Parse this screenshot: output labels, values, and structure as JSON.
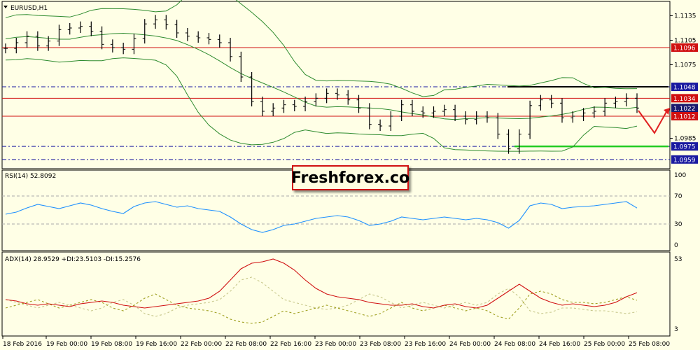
{
  "chart_data": {
    "type": "line",
    "symbol_label": "EURUSD,H1",
    "brand": "Freshforex.co",
    "price_axis": {
      "ticks": [
        {
          "value": 1.1135,
          "label": "1.1135"
        },
        {
          "value": 1.1105,
          "label": "1.1105"
        },
        {
          "value": 1.1075,
          "label": "1.1075"
        },
        {
          "value": 1.0985,
          "label": "1.0985"
        }
      ],
      "levels": [
        {
          "value": 1.1096,
          "label": "1.1096",
          "style": "red-solid"
        },
        {
          "value": 1.1048,
          "label": "1.1048",
          "style": "blue-dashdot"
        },
        {
          "value": 1.1034,
          "label": "1.1034",
          "style": "red-solid"
        },
        {
          "value": 1.1022,
          "label": "1.1022",
          "style": "current"
        },
        {
          "value": 1.1012,
          "label": "1.1012",
          "style": "red-solid"
        },
        {
          "value": 1.0975,
          "label": "1.0975",
          "style": "blue-dashdot"
        },
        {
          "value": 1.0959,
          "label": "1.0959",
          "style": "blue-dashdot"
        }
      ]
    },
    "time_axis": [
      "18 Feb 2016",
      "19 Feb 00:00",
      "19 Feb 08:00",
      "19 Feb 16:00",
      "22 Feb 00:00",
      "22 Feb 08:00",
      "22 Feb 16:00",
      "23 Feb 00:00",
      "23 Feb 08:00",
      "23 Feb 16:00",
      "24 Feb 00:00",
      "24 Feb 08:00",
      "24 Feb 16:00",
      "25 Feb 00:00",
      "25 Feb 08:00"
    ],
    "price_series": [
      1.1095,
      1.1102,
      1.111,
      1.1098,
      1.1104,
      1.1118,
      1.112,
      1.1122,
      1.1116,
      1.11,
      1.1096,
      1.1094,
      1.1107,
      1.1125,
      1.113,
      1.1124,
      1.1114,
      1.111,
      1.1108,
      1.1106,
      1.1102,
      1.1085,
      1.106,
      1.103,
      1.1018,
      1.1022,
      1.1026,
      1.1024,
      1.103,
      1.1034,
      1.104,
      1.1038,
      1.1032,
      1.1022,
      1.1002,
      1.1,
      1.1012,
      1.1026,
      1.1018,
      1.1016,
      1.1018,
      1.102,
      1.1012,
      1.1008,
      1.1012,
      1.101,
      1.099,
      1.0972,
      1.099,
      1.1025,
      1.1032,
      1.1028,
      1.101,
      1.1012,
      1.1016,
      1.1018,
      1.1028,
      1.103,
      1.1034,
      1.1022
    ],
    "levels_note_lines": {
      "resistance_black": 1.1048,
      "support_green": 1.0975
    },
    "rsi": {
      "label": "RSI(14) 52.8092",
      "ticks": [
        100,
        70,
        30,
        0
      ],
      "ylim": [
        0,
        100
      ],
      "values": [
        44,
        47,
        53,
        58,
        55,
        52,
        56,
        60,
        57,
        52,
        48,
        45,
        55,
        60,
        62,
        58,
        54,
        56,
        52,
        50,
        48,
        40,
        30,
        22,
        18,
        22,
        28,
        30,
        34,
        38,
        40,
        42,
        40,
        35,
        28,
        30,
        34,
        40,
        38,
        36,
        38,
        40,
        38,
        36,
        38,
        36,
        32,
        24,
        35,
        56,
        60,
        58,
        52,
        54,
        55,
        56,
        58,
        60,
        62,
        52.8
      ]
    },
    "adx": {
      "label": "ADX(14) 28.9529 +DI:23.5103 -DI:15.2576",
      "ticks": [
        53,
        3
      ],
      "ylim": [
        3,
        53
      ],
      "adx": [
        24,
        23,
        21,
        20,
        21,
        20,
        19,
        21,
        22,
        23,
        22,
        20,
        19,
        18,
        19,
        20,
        21,
        22,
        23,
        25,
        30,
        38,
        46,
        50,
        51,
        53,
        50,
        45,
        38,
        32,
        28,
        26,
        25,
        24,
        22,
        21,
        20,
        20,
        21,
        19,
        18,
        20,
        21,
        19,
        18,
        20,
        25,
        30,
        35,
        30,
        25,
        22,
        20,
        21,
        20,
        19,
        20,
        22,
        26,
        28.95
      ],
      "plus_di": [
        18,
        20,
        22,
        24,
        21,
        18,
        20,
        22,
        24,
        22,
        18,
        16,
        20,
        25,
        28,
        24,
        20,
        18,
        17,
        16,
        14,
        10,
        8,
        7,
        8,
        12,
        16,
        14,
        16,
        18,
        20,
        18,
        16,
        14,
        12,
        14,
        18,
        22,
        18,
        16,
        18,
        20,
        18,
        16,
        18,
        16,
        12,
        10,
        18,
        28,
        30,
        28,
        24,
        22,
        22,
        21,
        22,
        24,
        26,
        23.51
      ],
      "minus_di": [
        24,
        22,
        20,
        18,
        20,
        22,
        20,
        18,
        16,
        18,
        22,
        24,
        20,
        14,
        12,
        14,
        18,
        20,
        21,
        22,
        24,
        30,
        38,
        40,
        36,
        30,
        24,
        22,
        20,
        18,
        17,
        18,
        20,
        24,
        28,
        26,
        22,
        18,
        20,
        22,
        20,
        18,
        20,
        22,
        20,
        22,
        28,
        32,
        26,
        16,
        14,
        15,
        18,
        18,
        17,
        16,
        16,
        15,
        14,
        15.26
      ]
    }
  }
}
